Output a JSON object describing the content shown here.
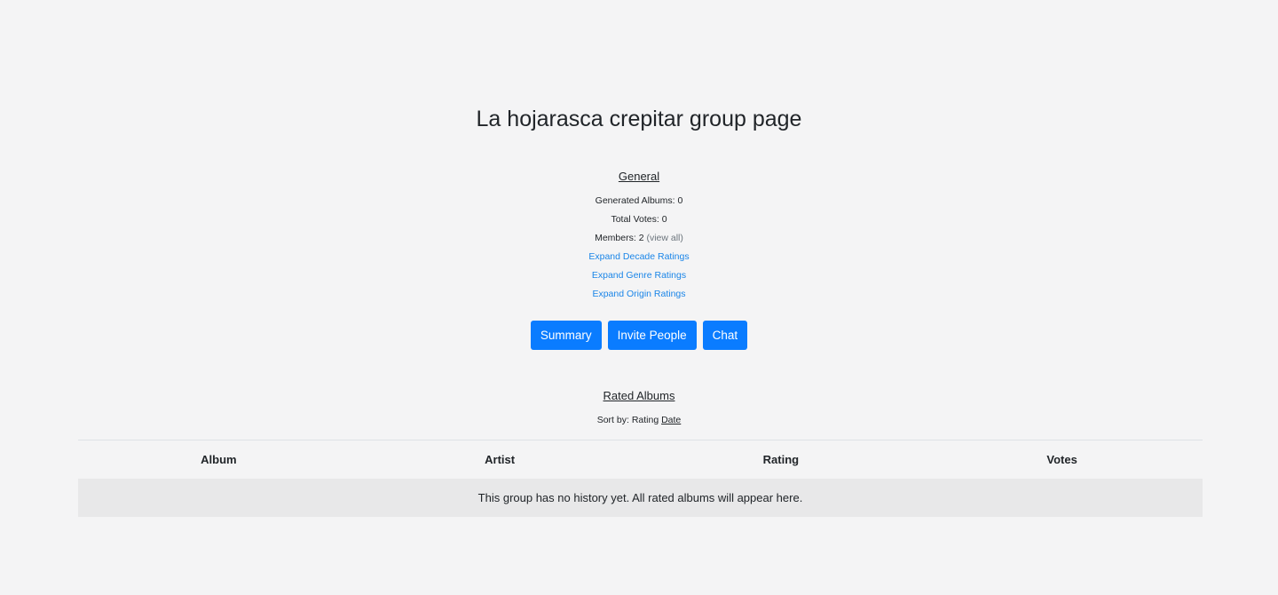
{
  "page": {
    "title": "La hojarasca crepitar group page"
  },
  "general": {
    "heading": "General",
    "generated_albums_label": "Generated Albums:",
    "generated_albums_value": "0",
    "total_votes_label": "Total Votes:",
    "total_votes_value": "0",
    "members_label": "Members:",
    "members_value": "2",
    "view_all_label": "(view all)",
    "expand_decade": "Expand Decade Ratings",
    "expand_genre": "Expand Genre Ratings",
    "expand_origin": "Expand Origin Ratings"
  },
  "actions": {
    "summary": "Summary",
    "invite": "Invite People",
    "chat": "Chat"
  },
  "rated": {
    "heading": "Rated Albums",
    "sort_label": "Sort by:",
    "sort_rating": "Rating",
    "sort_date": "Date"
  },
  "table": {
    "columns": [
      "Album",
      "Artist",
      "Rating",
      "Votes"
    ],
    "empty_message": "This group has no history yet. All rated albums will appear here."
  },
  "colors": {
    "background": "#f4f4f5",
    "button": "#0a7cff",
    "link": "#1a85e8",
    "empty_row": "#e8e8e9"
  }
}
